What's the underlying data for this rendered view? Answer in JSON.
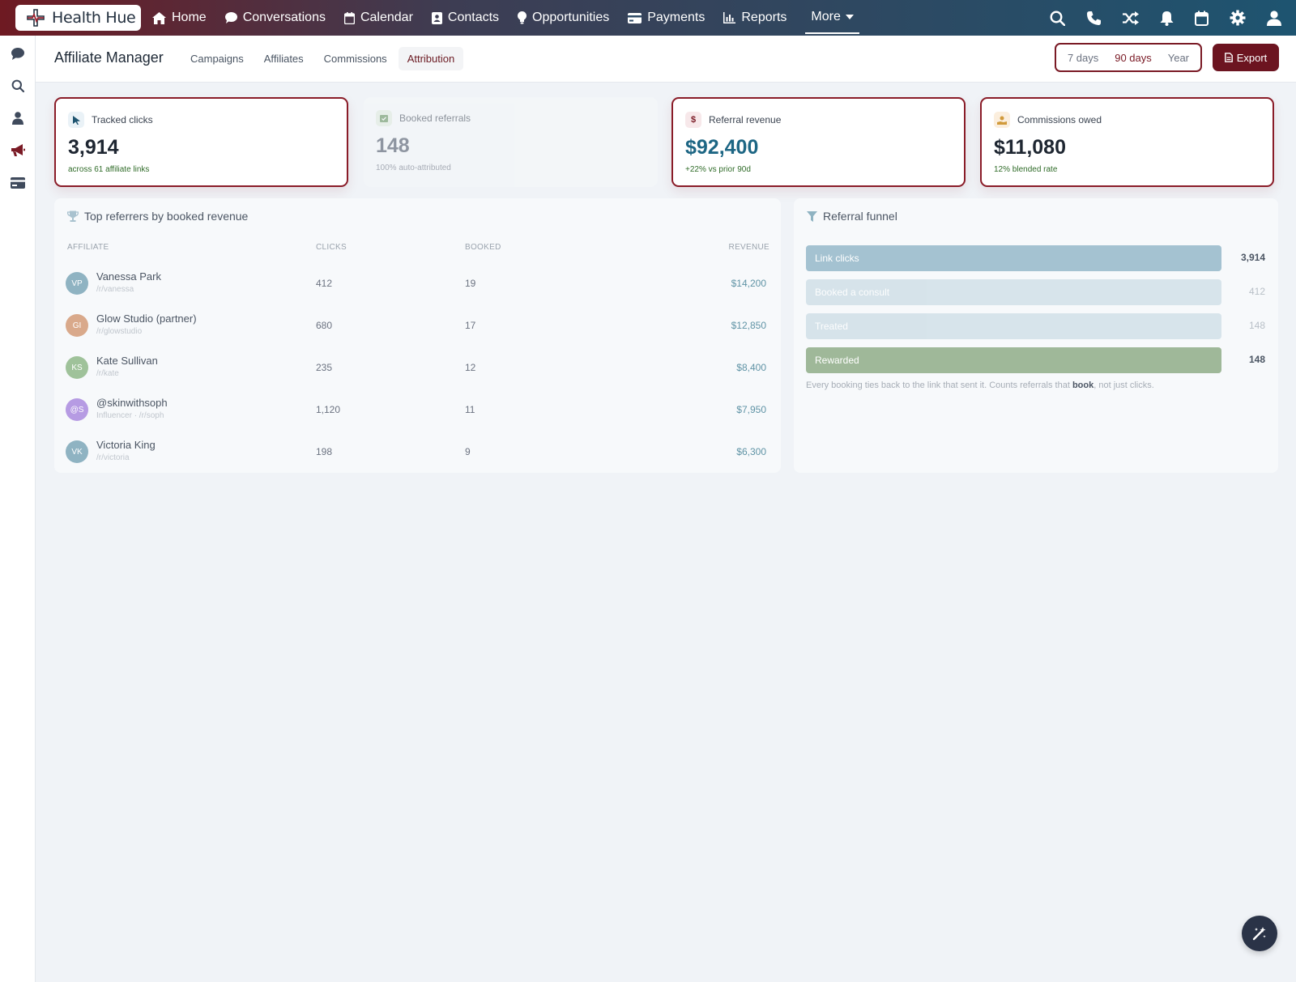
{
  "brand": {
    "name": "Health Hue"
  },
  "nav": {
    "items": [
      {
        "label": "Home",
        "icon": "home-icon"
      },
      {
        "label": "Conversations",
        "icon": "chat-bubble-icon"
      },
      {
        "label": "Calendar",
        "icon": "calendar-icon"
      },
      {
        "label": "Contacts",
        "icon": "contact-card-icon"
      },
      {
        "label": "Opportunities",
        "icon": "lightbulb-icon"
      },
      {
        "label": "Payments",
        "icon": "credit-card-icon"
      },
      {
        "label": "Reports",
        "icon": "bar-chart-icon"
      }
    ],
    "more_label": "More",
    "right_icons": [
      "search-icon",
      "phone-icon",
      "shuffle-icon",
      "bell-icon",
      "calendar-icon",
      "gear-icon",
      "user-icon"
    ]
  },
  "sidebar": {
    "icons": [
      "chat-icon",
      "search-icon",
      "user-icon",
      "megaphone-icon",
      "card-icon"
    ],
    "active": "megaphone-icon"
  },
  "header": {
    "title": "Affiliate Manager",
    "tabs": [
      "Campaigns",
      "Affiliates",
      "Commissions",
      "Attribution"
    ],
    "active_tab": "Attribution",
    "ranges": [
      "7 days",
      "90 days",
      "Year"
    ],
    "selected_range": "90 days",
    "export_label": "Export"
  },
  "kpis": [
    {
      "label": "Tracked clicks",
      "value": "3,914",
      "sub": "across 61 affiliate links",
      "icon": "cursor-icon",
      "dimmed": false
    },
    {
      "label": "Booked referrals",
      "value": "148",
      "sub": "100% auto-attributed",
      "icon": "calendar-check-icon",
      "dimmed": true
    },
    {
      "label": "Referral revenue",
      "value": "$92,400",
      "sub": "+22% vs prior 90d",
      "icon": "dollar-icon",
      "dimmed": false
    },
    {
      "label": "Commissions owed",
      "value": "$11,080",
      "sub": "12% blended rate",
      "icon": "hand-coin-icon",
      "dimmed": false
    }
  ],
  "referrers": {
    "title": "Top referrers by booked revenue",
    "columns": [
      "AFFILIATE",
      "CLICKS",
      "BOOKED",
      "REVENUE"
    ],
    "rows": [
      {
        "initials": "VP",
        "name": "Vanessa Park",
        "sub": "/r/vanessa",
        "clicks": "412",
        "booked": "19",
        "revenue": "$14,200",
        "color": "#8fb3c2"
      },
      {
        "initials": "GI",
        "name": "Glow Studio (partner)",
        "sub": "/r/glowstudio",
        "clicks": "680",
        "booked": "17",
        "revenue": "$12,850",
        "color": "#d9a98b"
      },
      {
        "initials": "KS",
        "name": "Kate Sullivan",
        "sub": "/r/kate",
        "clicks": "235",
        "booked": "12",
        "revenue": "$8,400",
        "color": "#9fc29a"
      },
      {
        "initials": "@S",
        "name": "@skinwithsoph",
        "sub": "Influencer · /r/soph",
        "clicks": "1,120",
        "booked": "11",
        "revenue": "$7,950",
        "color": "#b69be3"
      },
      {
        "initials": "VK",
        "name": "Victoria King",
        "sub": "/r/victoria",
        "clicks": "198",
        "booked": "9",
        "revenue": "$6,300",
        "color": "#8fb3c2"
      }
    ]
  },
  "funnel": {
    "title": "Referral funnel",
    "stages": [
      {
        "label": "Link clicks",
        "value": "3,914",
        "color": "#a4c2d1"
      },
      {
        "label": "Booked a consult",
        "value": "412",
        "color": "#c9dbe4"
      },
      {
        "label": "Treated",
        "value": "148",
        "color": "#c9dbe4"
      },
      {
        "label": "Rewarded",
        "value": "148",
        "color": "#9fb899"
      }
    ],
    "note_pre": "Every booking ties back to the link that sent it. Counts referrals that ",
    "note_bold": "book",
    "note_post": ", not just clicks."
  }
}
